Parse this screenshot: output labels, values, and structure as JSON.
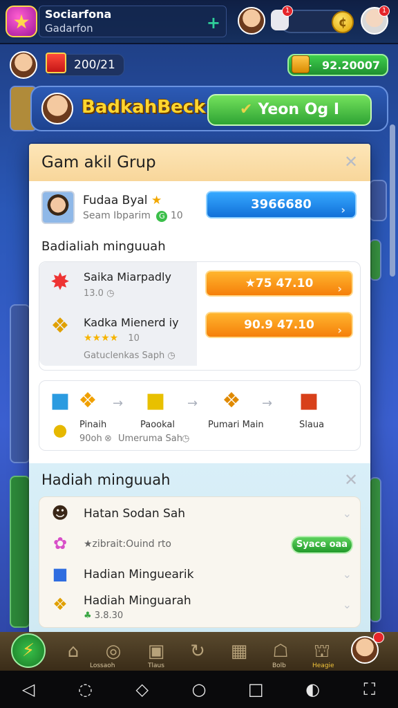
{
  "topbar": {
    "app_title": "Sociarfona",
    "app_subtitle": "Gadarfon",
    "plus": "+",
    "notif_count_1": "1",
    "notif_count_2": "1"
  },
  "resources": {
    "left_value": "200/21",
    "right_value": "92.20007",
    "right_plus": "+"
  },
  "banner": {
    "name": "BadkahBeck",
    "go_label": "Yeon Og I"
  },
  "modal": {
    "title": "Gam akil Grup",
    "player_name": "Fudaa Byal",
    "player_sub": "Seam Ibparim",
    "player_sub_badge": "10",
    "player_button": "3966680",
    "rewards_title": "Badialiah minguuah",
    "rewards": [
      {
        "name": "Saika Miarpadly",
        "sub": "13.0",
        "button": "75 47.10"
      },
      {
        "name": "Kadka Mienerd iy",
        "rating": "★★★★",
        "sub": "10",
        "button": "90.9 47.10"
      }
    ],
    "rewards_footer": "Gatuclenkas Saph",
    "flow": [
      {
        "label": "Pinaih",
        "sub": "90oh"
      },
      {
        "label": "Paookal",
        "sub": "Umeruma Sah"
      },
      {
        "label": "Pumari Main",
        "sub": ""
      },
      {
        "label": "Slaua",
        "sub": ""
      }
    ]
  },
  "sub_panel": {
    "title": "Hadiah minguuah",
    "items": [
      {
        "text": "Hatan Sodan Sah"
      },
      {
        "text": "★zibrait:Ouind rto",
        "button": "Syace oaa"
      },
      {
        "text": "Hadian Minguearik"
      },
      {
        "text": "Hadiah Minguarah",
        "sub": "3.8.30"
      }
    ]
  },
  "bottom_tabs": [
    "Lossaoh",
    "Tlaus",
    "Bolb",
    "Heagie"
  ],
  "colors": {
    "accent_orange": "#f57f0a",
    "accent_blue": "#1270d8",
    "accent_green": "#2ea334",
    "header_bg": "#f8d69a"
  }
}
